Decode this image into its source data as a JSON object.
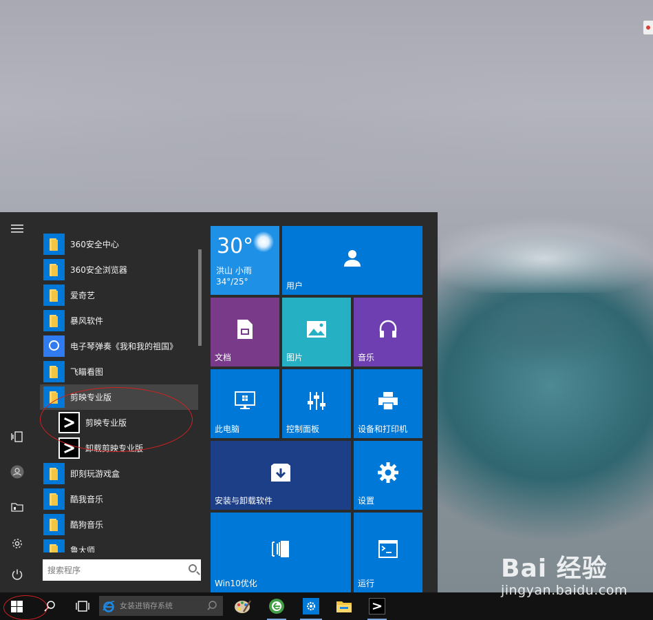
{
  "start_menu": {
    "rail": [
      {
        "name": "hamburger-menu-icon",
        "glyph": "☰"
      },
      {
        "name": "tablet-mode-icon",
        "glyph": "▯"
      },
      {
        "name": "user-account-icon",
        "glyph": "👤"
      },
      {
        "name": "documents-icon",
        "glyph": "▭"
      },
      {
        "name": "settings-icon",
        "glyph": "⚙"
      },
      {
        "name": "power-icon",
        "glyph": "⏻"
      }
    ],
    "apps": [
      {
        "label": "360安全中心",
        "icon": "folder"
      },
      {
        "label": "360安全浏览器",
        "icon": "folder"
      },
      {
        "label": "爱奇艺",
        "icon": "folder"
      },
      {
        "label": "暴风软件",
        "icon": "folder"
      },
      {
        "label": "电子琴弹奏《我和我的祖国》",
        "icon": "baidu-netdisk"
      },
      {
        "label": "飞瞄看图",
        "icon": "folder"
      },
      {
        "label": "剪映专业版",
        "icon": "folder"
      },
      {
        "label": "剪映专业版",
        "icon": "capcut"
      },
      {
        "label": "卸载剪映专业版",
        "icon": "capcut"
      },
      {
        "label": "即刻玩游戏盒",
        "icon": "folder"
      },
      {
        "label": "酷我音乐",
        "icon": "folder"
      },
      {
        "label": "酷狗音乐",
        "icon": "folder"
      },
      {
        "label": "鲁大师",
        "icon": "folder"
      }
    ],
    "search_placeholder": "搜索程序",
    "tiles": {
      "weather": {
        "temp": "30°",
        "location": "洪山  小雨",
        "range": "34°/25°"
      },
      "user": "用户",
      "documents": "文档",
      "pictures": "图片",
      "music": "音乐",
      "this_pc": "此电脑",
      "control_panel": "控制面板",
      "devices_printers": "设备和打印机",
      "install_uninstall": "安装与卸载软件",
      "settings": "设置",
      "win10_optimize": "Win10优化",
      "run": "运行"
    }
  },
  "taskbar": {
    "search_placeholder": "女装进销存系统",
    "apps": [
      {
        "name": "paint-icon",
        "glyph": "🎨"
      },
      {
        "name": "360-browser-icon",
        "glyph": "e"
      },
      {
        "name": "settings-app-icon",
        "glyph": "⚙"
      },
      {
        "name": "file-explorer-icon",
        "glyph": "▬"
      },
      {
        "name": "capcut-icon",
        "glyph": "✂"
      }
    ]
  },
  "watermark": {
    "brand": "Bai  经验",
    "url": "jingyan.baidu.com"
  },
  "colors": {
    "tile_blue": "#0078d7",
    "tile_purple": "#7a3a8a",
    "tile_teal": "#26b0c3",
    "tile_violet": "#6e3fb0",
    "tile_dark_blue": "#1d3f88",
    "annotation_red": "#d42020"
  }
}
